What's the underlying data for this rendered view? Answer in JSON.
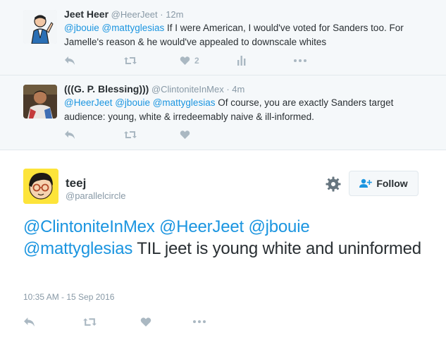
{
  "replies": [
    {
      "fullname": "Jeet Heer",
      "handle": "@HeerJeet",
      "time": "· 12m",
      "text_mentions": "@jbouie @mattyglesias",
      "text_body": " If I were American, I would've voted for Sanders too. For Jamelle's reason &  he would've appealed to downscale whites",
      "like_count": "2",
      "actions": [
        "reply-icon",
        "retweet-icon",
        "like-icon",
        "analytics-icon",
        "more-icon"
      ]
    },
    {
      "fullname": "(((G. P. Blessing)))",
      "handle": "@ClintoniteInMex",
      "time": "· 4m",
      "text_mentions": "@HeerJeet @jbouie @mattyglesias",
      "text_body": " Of course, you are exactly Sanders target audience: young, white & irredeemably naive & ill-informed.",
      "actions": [
        "reply-icon",
        "retweet-icon",
        "like-icon",
        "more-icon"
      ]
    }
  ],
  "main_tweet": {
    "fullname": "teej",
    "handle": "@parallelcircle",
    "follow_label": "Follow",
    "mentions_line1": "@ClintoniteInMex @HeerJeet @jbouie",
    "mentions_line2": "@mattyglesias",
    "text_body": " TIL jeet is young white and uninformed",
    "timestamp": "10:35 AM - 15 Sep 2016",
    "actions": [
      "reply-icon",
      "retweet-icon",
      "like-icon",
      "more-icon"
    ]
  },
  "colors": {
    "link": "#1b95e0",
    "muted": "#8899a6",
    "icon": "#aab8c2",
    "text": "#292f33",
    "reply_bg": "#f5f8fa"
  }
}
